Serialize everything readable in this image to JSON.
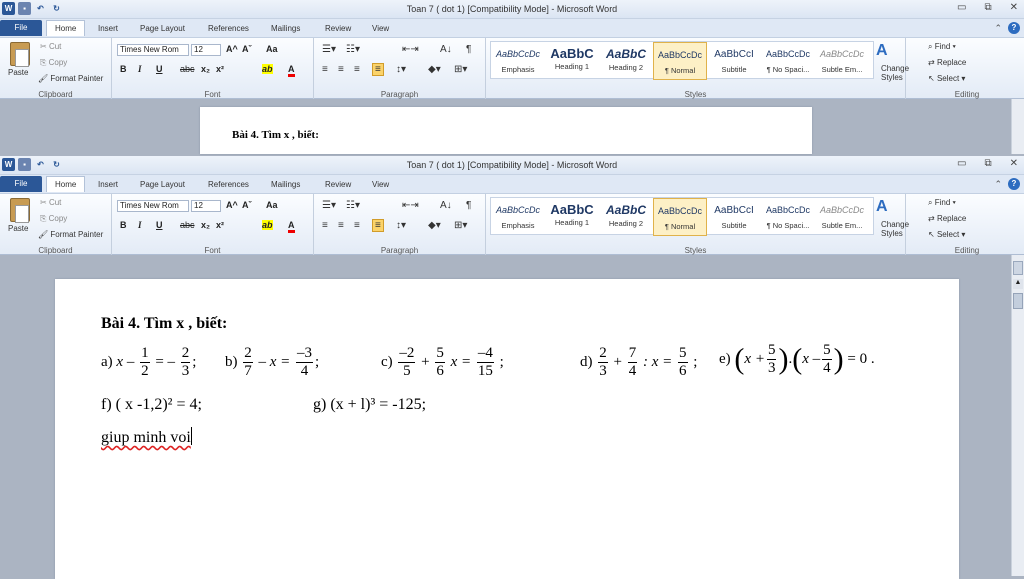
{
  "window": {
    "title": "Toan 7 ( dot 1) [Compatibility Mode] - Microsoft Word",
    "controls": [
      "▭",
      "⧉",
      "✕"
    ]
  },
  "tabs": [
    "File",
    "Home",
    "Insert",
    "Page Layout",
    "References",
    "Mailings",
    "Review",
    "View"
  ],
  "clipboard": {
    "paste": "Paste",
    "cut": "Cut",
    "copy": "Copy",
    "format_painter": "Format Painter",
    "label": "Clipboard"
  },
  "font": {
    "name": "Times New Rom",
    "size": "12",
    "label": "Font",
    "bold": "B",
    "italic": "I",
    "underline": "U",
    "strike": "abc",
    "sub": "x₂",
    "sup": "x²",
    "grow": "A^",
    "shrink": "Aˇ",
    "case": "Aa",
    "highlight": "ab",
    "color": "A"
  },
  "paragraph": {
    "label": "Paragraph"
  },
  "styles": {
    "label": "Styles",
    "items": [
      {
        "preview": "AaBbCcDc",
        "name": "Emphasis"
      },
      {
        "preview": "AaBbC",
        "name": "Heading 1"
      },
      {
        "preview": "AaBbC",
        "name": "Heading 2"
      },
      {
        "preview": "AaBbCcDc",
        "name": "¶ Normal"
      },
      {
        "preview": "AaBbCcI",
        "name": "Subtitle"
      },
      {
        "preview": "AaBbCcDc",
        "name": "¶ No Spaci..."
      },
      {
        "preview": "AaBbCcDc",
        "name": "Subtle Em..."
      }
    ],
    "change": "Change Styles"
  },
  "editing": {
    "label": "Editing",
    "find": "Find",
    "replace": "Replace",
    "select": "Select"
  },
  "doc": {
    "heading": "Bài 4. Tìm x , biết:",
    "a_label": "a)",
    "a_x": "x",
    "a_minus": "–",
    "a_f1n": "1",
    "a_f1d": "2",
    "a_eq": "= –",
    "a_f2n": "2",
    "a_f2d": "3",
    "a_end": ";",
    "b_label": "b)",
    "b_f1n": "2",
    "b_f1d": "7",
    "b_mid": "– x =",
    "b_f2n": "–3",
    "b_f2d": "4",
    "b_end": ";",
    "c_label": "c)",
    "c_f1n": "–2",
    "c_f1d": "5",
    "c_plus": "+",
    "c_f2n": "5",
    "c_f2d": "6",
    "c_x": "x =",
    "c_f3n": "–4",
    "c_f3d": "15",
    "c_end": ";",
    "d_label": "d)",
    "d_f1n": "2",
    "d_f1d": "3",
    "d_plus": "+",
    "d_f2n": "7",
    "d_f2d": "4",
    "d_mid": ": x =",
    "d_f3n": "5",
    "d_f3d": "6",
    "d_end": ";",
    "e_label": "e)",
    "e_x1": "x +",
    "e_f1n": "5",
    "e_f1d": "3",
    "e_dot": ".",
    "e_x2": "x –",
    "e_f2n": "5",
    "e_f2d": "4",
    "e_end": "= 0 .",
    "f_line": "f) ( x -1,2)² = 4;",
    "g_line": "g) (x + l)³ = -125;",
    "note": "giup minh voi"
  }
}
